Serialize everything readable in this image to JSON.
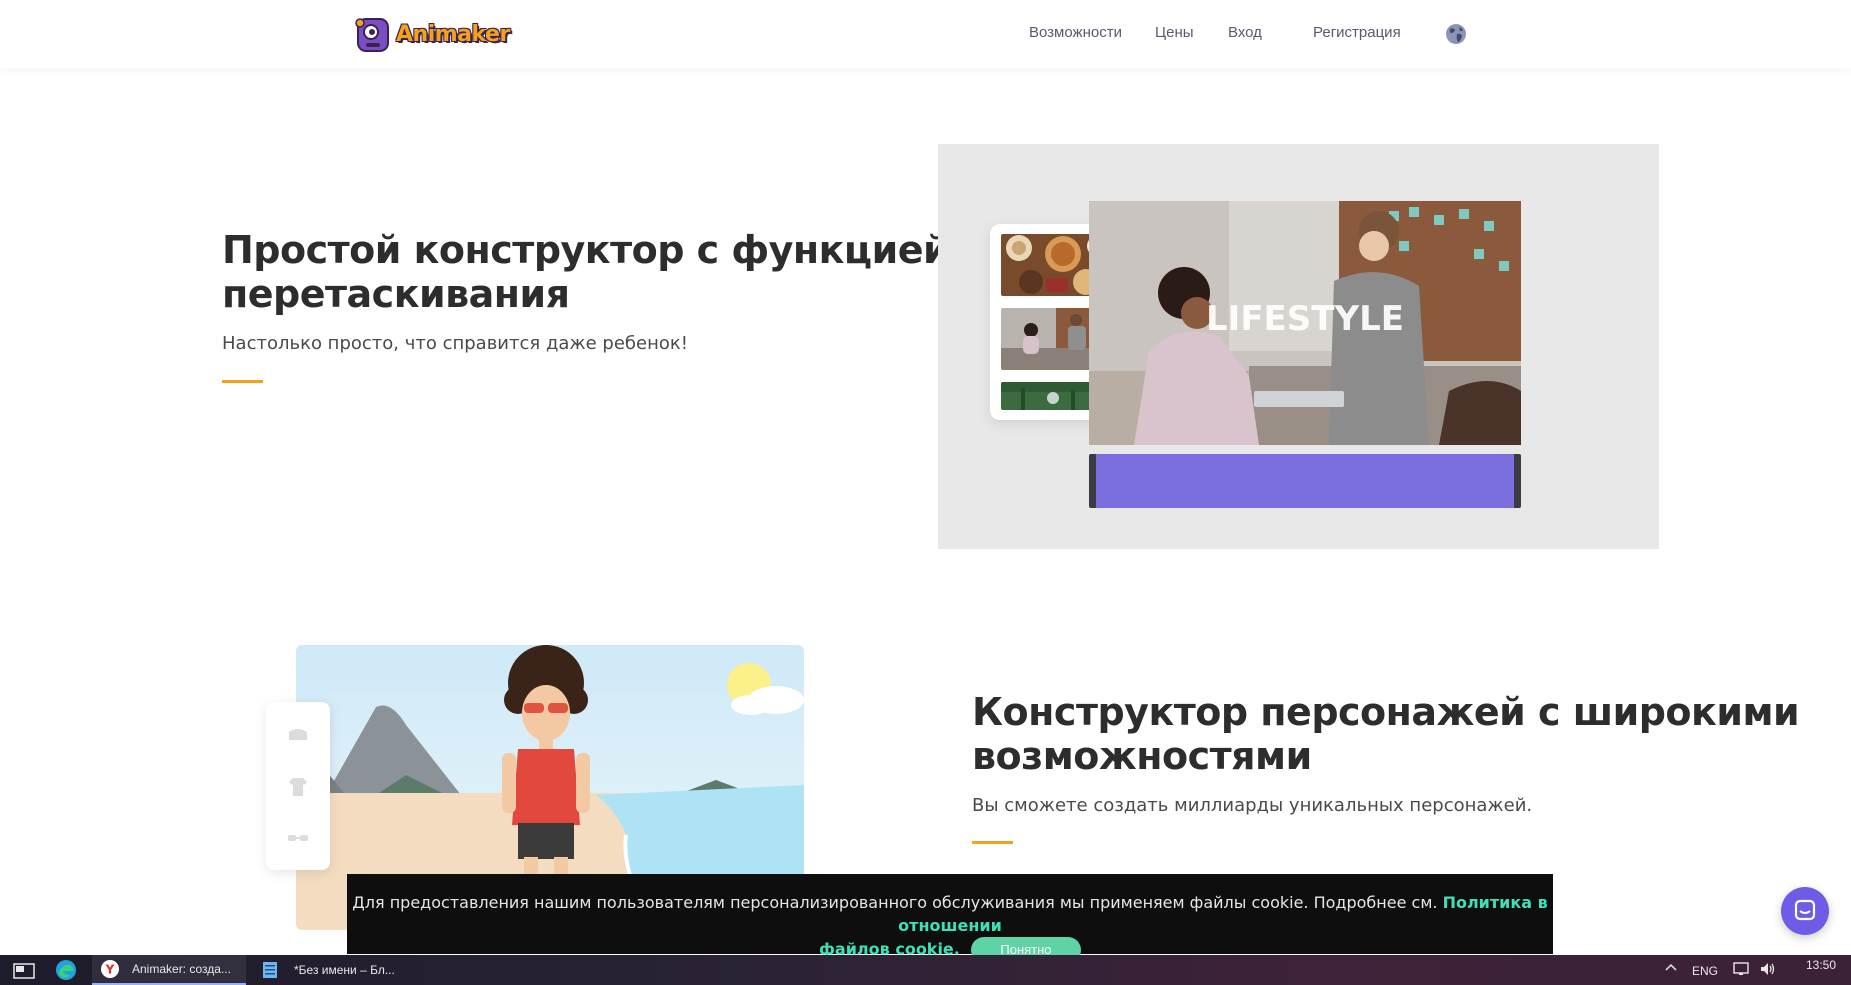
{
  "header": {
    "logo_text": "Animaker",
    "nav": {
      "features": "Возможности",
      "prices": "Цены",
      "login": "Вход",
      "signup": "Регистрация"
    }
  },
  "section_dragdrop": {
    "title_line1": "Простой конструктор с функцией",
    "title_line2": "перетаскивания",
    "subtitle": "Настолько просто, что справится даже ребенок!",
    "preview_label": "LIFESTYLE"
  },
  "section_character": {
    "title_line1": "Конструктор персонажей с широкими",
    "title_line2": "возможностями",
    "subtitle": "Вы сможете создать миллиарды уникальных персонажей."
  },
  "cookie": {
    "text": "Для предоставления нашим пользователям персонализированного обслуживания мы применяем файлы cookie. Подробнее см.",
    "link_part1": "Политика в отношении",
    "link_part2": "файлов cookie.",
    "accept": "Понятно"
  },
  "taskbar": {
    "browser_tab": "Animaker: созда...",
    "notepad_tab": "*Без имени – Бл...",
    "lang": "ENG",
    "time": "13:50"
  },
  "colors": {
    "accent_orange": "#f4a11c",
    "timeline_purple": "#7b6fe0",
    "cookie_link": "#3fe0b8",
    "accept_button": "#5fd3a6",
    "chat_button": "#6c5ce7"
  }
}
